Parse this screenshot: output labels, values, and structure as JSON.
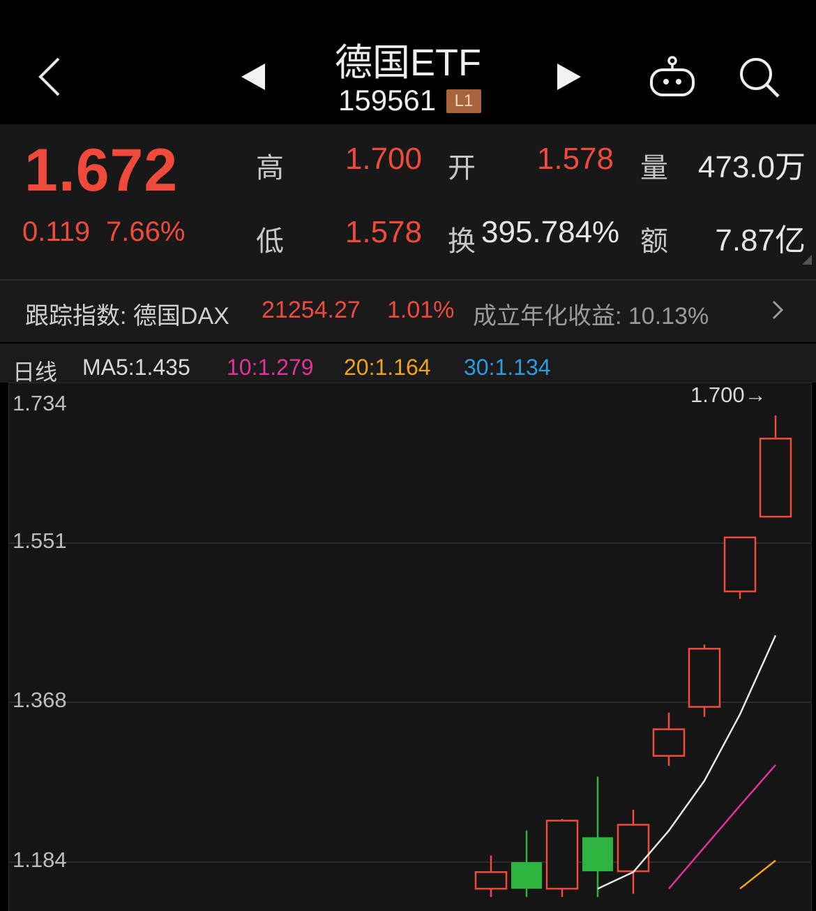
{
  "header": {
    "title": "德国ETF",
    "code": "159561",
    "level_badge": "L1"
  },
  "quote": {
    "price": "1.672",
    "change": "0.119",
    "change_pct": "7.66%",
    "high_label": "高",
    "high": "1.700",
    "open_label": "开",
    "open": "1.578",
    "volume_label": "量",
    "volume": "473.0万",
    "low_label": "低",
    "low": "1.578",
    "turnover_label": "换",
    "turnover": "395.784%",
    "amount_label": "额",
    "amount": "7.87亿"
  },
  "tracking": {
    "label": "跟踪指数: 德国DAX",
    "index_value": "21254.27",
    "index_pct": "1.01%",
    "annualized": "成立年化收益: 10.13%"
  },
  "ma": {
    "period": "日线",
    "ma5": "MA5:1.435",
    "ma10": "10:1.279",
    "ma20": "20:1.164",
    "ma30": "30:1.134"
  },
  "colors": {
    "up": "#f04a3d",
    "down": "#2db33e",
    "ma5": "#e6e6e6",
    "ma10": "#e0339c",
    "ma20": "#f0a21f",
    "ma30": "#2d9be0"
  },
  "chart_data": {
    "type": "candlestick",
    "y_ticks": [
      "1.734",
      "1.551",
      "1.368",
      "1.184"
    ],
    "ylim": [
      1.15,
      1.734
    ],
    "max_label": "1.700→",
    "candles": [
      {
        "open": 1.13,
        "close": 1.15,
        "high": 1.17,
        "low": 1.12,
        "dir": "up"
      },
      {
        "open": 1.162,
        "close": 1.13,
        "high": 1.2,
        "low": 1.12,
        "dir": "down"
      },
      {
        "open": 1.13,
        "close": 1.212,
        "high": 1.214,
        "low": 1.12,
        "dir": "up"
      },
      {
        "open": 1.192,
        "close": 1.151,
        "high": 1.265,
        "low": 1.12,
        "dir": "down"
      },
      {
        "open": 1.151,
        "close": 1.207,
        "high": 1.225,
        "low": 1.124,
        "dir": "up"
      },
      {
        "open": 1.29,
        "close": 1.322,
        "high": 1.342,
        "low": 1.278,
        "dir": "up"
      },
      {
        "open": 1.349,
        "close": 1.419,
        "high": 1.424,
        "low": 1.337,
        "dir": "up"
      },
      {
        "open": 1.488,
        "close": 1.553,
        "high": 1.553,
        "low": 1.479,
        "dir": "up"
      },
      {
        "open": 1.578,
        "close": 1.672,
        "high": 1.7,
        "low": 1.578,
        "dir": "up"
      }
    ],
    "ma_lines": {
      "ma5": [
        1.13,
        1.15,
        1.2,
        1.26,
        1.34,
        1.435
      ],
      "ma10": [
        1.13,
        1.18,
        1.23,
        1.279
      ],
      "ma20": [
        1.13,
        1.164
      ]
    }
  }
}
